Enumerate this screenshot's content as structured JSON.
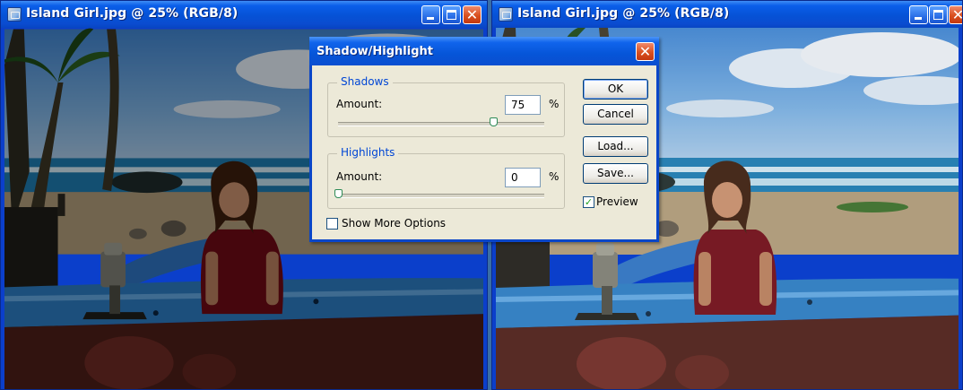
{
  "left_window": {
    "title": "Island Girl.jpg @ 25% (RGB/8)",
    "icons": [
      "photoshop-doc-icon",
      "minimize-icon",
      "maximize-icon",
      "close-icon"
    ]
  },
  "right_window": {
    "title": "Island Girl.jpg @ 25% (RGB/8)",
    "icons": [
      "photoshop-doc-icon",
      "minimize-icon",
      "maximize-icon",
      "close-icon"
    ]
  },
  "dialog": {
    "title": "Shadow/Highlight",
    "shadows": {
      "legend": "Shadows",
      "amount_label": "Amount:",
      "amount_value": "75",
      "unit": "%",
      "slider_percent": 75
    },
    "highlights": {
      "legend": "Highlights",
      "amount_label": "Amount:",
      "amount_value": "0",
      "unit": "%",
      "slider_percent": 0
    },
    "buttons": {
      "ok": "OK",
      "cancel": "Cancel",
      "load": "Load...",
      "save": "Save..."
    },
    "preview_label": "Preview",
    "preview_checked": true,
    "show_more_label": "Show More Options",
    "show_more_checked": false
  },
  "colors": {
    "xp_title_blue": "#0652d6",
    "close_red": "#d9501f",
    "dialog_face": "#ece9d8",
    "group_legend": "#0046d5"
  }
}
